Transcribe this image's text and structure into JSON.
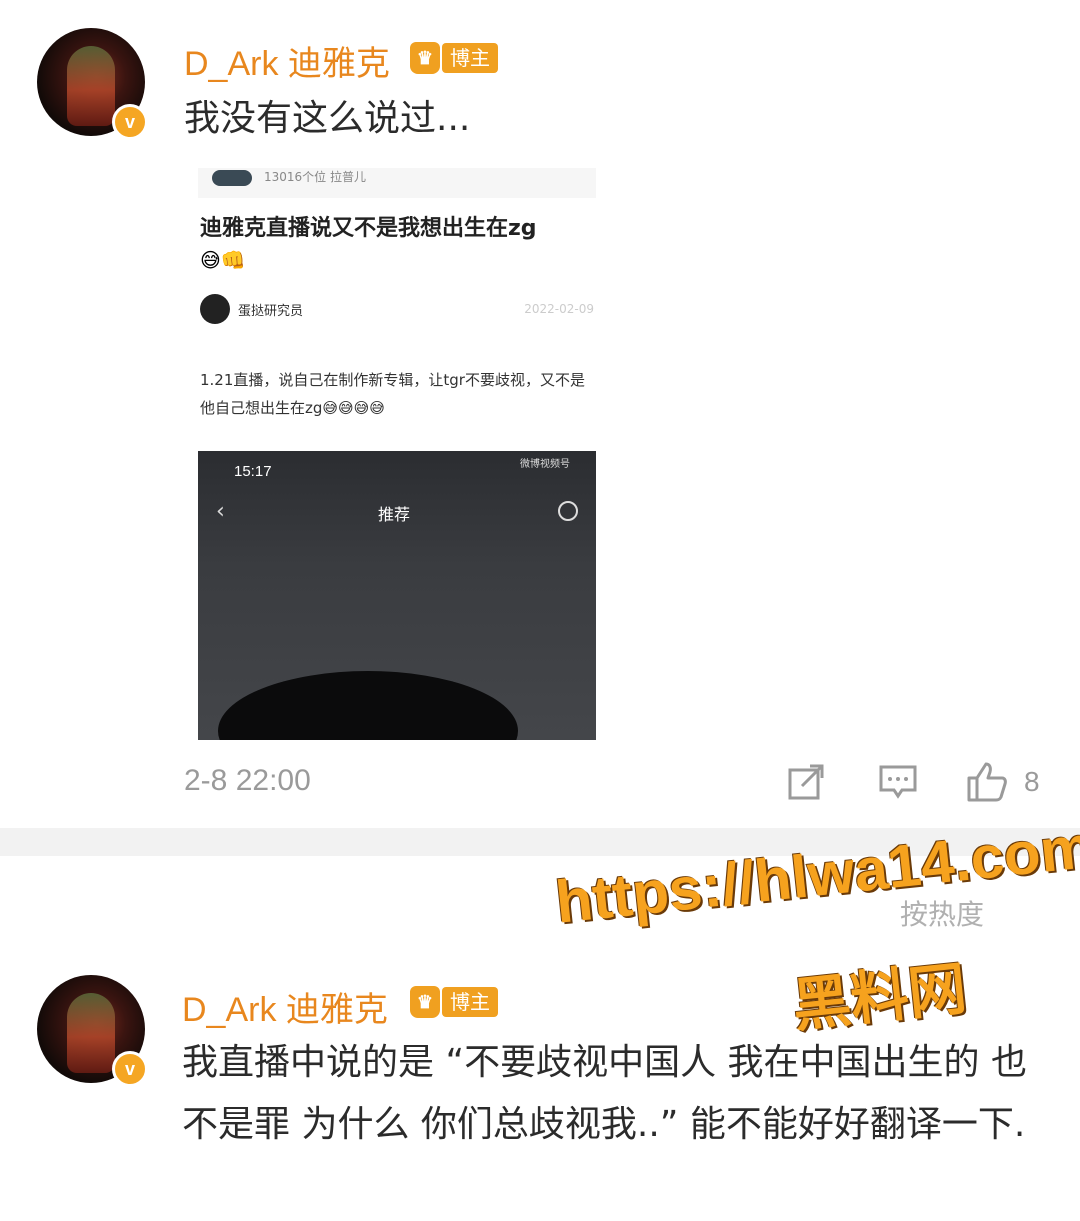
{
  "comment1": {
    "username": "D_Ark 迪雅克",
    "badge": "博主",
    "text": "我没有这么说过...",
    "embed": {
      "header_meta": "13016个位 拉普儿",
      "title": "迪雅克直播说又不是我想出生在zg",
      "title_emoji": "😅👊",
      "author": "蛋挞研究员",
      "date": "2022-02-09",
      "body": "1.21直播，说自己在制作新专辑，让tgr不要歧视，又不是他自己想出生在zg😅😅😅😅",
      "video": {
        "time": "15:17",
        "status": "微博视频号",
        "title": "推荐"
      }
    },
    "timestamp": "2-8 22:00",
    "like_count": "8"
  },
  "sort_label": "按热度",
  "comment2": {
    "username": "D_Ark 迪雅克",
    "badge": "博主",
    "text": "我直播中说的是 “不要歧视中国人 我在中国出生的 也不是罪 为什么 你们总歧视我..” 能不能好好翻译一下."
  },
  "watermark": {
    "url": "https://hlwa14.com",
    "name": "黑料网"
  },
  "colors": {
    "username": "#e8871e",
    "badge": "#f0a020",
    "verified": "#f5a623",
    "watermark": "#f6a21e"
  }
}
